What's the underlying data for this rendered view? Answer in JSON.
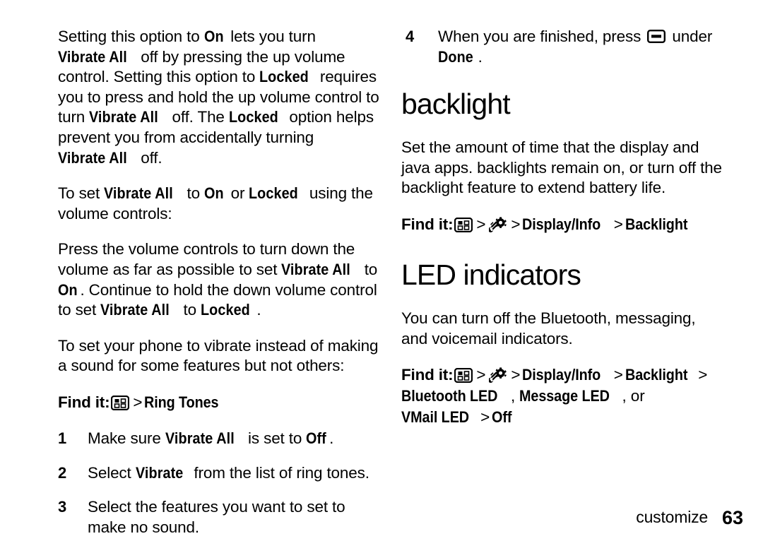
{
  "document": {
    "type": "phone-user-guide-page",
    "footer": {
      "section_label": "customize",
      "page_number": "63"
    }
  },
  "icons": {
    "menu": "menu-key-icon",
    "settings": "settings-wrench-gear-icon",
    "softkey": "soft-key-icon"
  },
  "left_column": {
    "paragraph_1": {
      "p1": "Setting this option to ",
      "b1": "On",
      "p2": " lets you turn ",
      "b2": "Vibrate All",
      "p3": " off by pressing the up volume control. Setting this option to ",
      "b3": "Locked",
      "p4": " requires you to press and hold the up volume control to turn ",
      "b4": "Vibrate All",
      "p5": " off. The ",
      "b5": "Locked",
      "p6": " option helps prevent you from accidentally turning ",
      "b6": "Vibrate All",
      "p7": " off."
    },
    "paragraph_2": {
      "p1": "To set ",
      "b1": "Vibrate All",
      "p2": " to ",
      "b2": "On",
      "p3": " or ",
      "b3": "Locked",
      "p4": " using the volume controls:"
    },
    "paragraph_3": {
      "p1": "Press the volume controls to turn down the volume as far as possible to set ",
      "b1": "Vibrate All",
      "p2": " to ",
      "b2": "On",
      "p3": ". Continue to hold the down volume control to set ",
      "b3": "Vibrate All",
      "p4": " to ",
      "b4": "Locked",
      "p5": "."
    },
    "paragraph_4": {
      "p1": "To set your phone to vibrate instead of making a sound for some features but not others:"
    },
    "find_it": {
      "label": "Find it:",
      "chevron": ">",
      "path_1": "Ring Tones"
    },
    "steps": [
      {
        "number": "1",
        "p1": "Make sure ",
        "b1": "Vibrate All",
        "p2": " is set to ",
        "b2": "Off",
        "p3": "."
      },
      {
        "number": "2",
        "p1": "Select ",
        "b1": "Vibrate",
        "p2": " from the list of ring tones.",
        "b2": "",
        "p3": ""
      },
      {
        "number": "3",
        "p1": "Select the features you want to set to make no sound.",
        "b1": "",
        "p2": "",
        "b2": "",
        "p3": ""
      }
    ]
  },
  "right_column": {
    "step_4": {
      "number": "4",
      "p1": "When you are finished, press ",
      "p2": " under ",
      "b1": "Done",
      "p3": "."
    },
    "backlight": {
      "heading": "backlight",
      "paragraph": "Set the amount of time that the display and java apps. backlights remain on, or turn off the backlight feature to extend battery life.",
      "find_it": {
        "label": "Find it:",
        "chevron": ">",
        "path_1": "Display/Info",
        "path_2": "Backlight"
      }
    },
    "led_indicators": {
      "heading": "LED indicators",
      "paragraph": "You can turn off the Bluetooth, messaging, and voicemail indicators.",
      "find_it": {
        "label": "Find it:",
        "chevron": ">",
        "path_1": "Display/Info",
        "path_2": "Backlight",
        "path_3": "Bluetooth LED",
        "comma_1": ",",
        "path_4": "Message LED",
        "comma_2": ",",
        "or_word": "or",
        "path_5": "VMail LED",
        "path_6": "Off"
      }
    }
  }
}
